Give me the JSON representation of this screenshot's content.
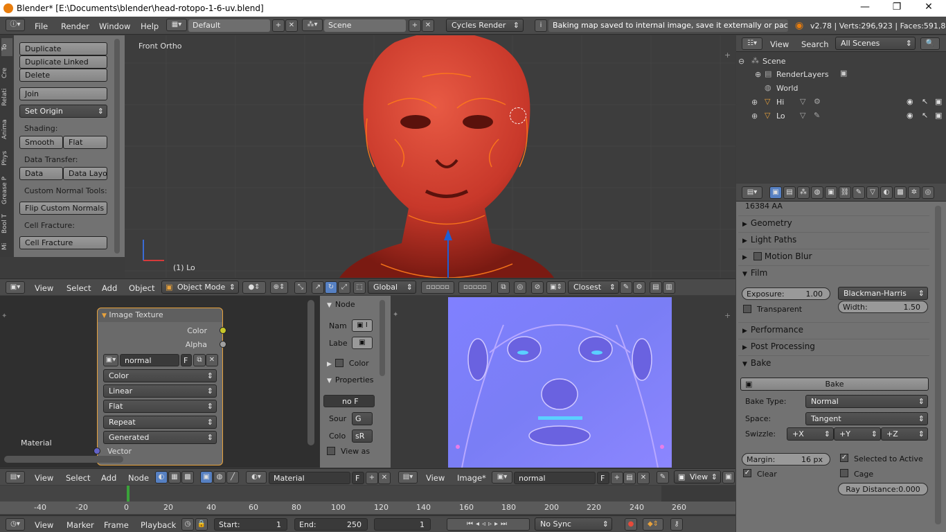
{
  "window": {
    "title": "Blender* [E:\\Documents\\blender\\head-rotopo-1-6-uv.blend]",
    "minimize": "—",
    "maximize": "❐",
    "close": "✕"
  },
  "topbar": {
    "menus": [
      "File",
      "Render",
      "Window",
      "Help"
    ],
    "screen_layout": "Default",
    "scene": "Scene",
    "render_engine": "Cycles Render",
    "status_message": "Baking map saved to internal image, save it externally or pack it",
    "stats": "v2.78 | Verts:296,923 | Faces:591,80"
  },
  "tool_shelf": {
    "tabs": [
      "To",
      "Cre",
      "Relati",
      "Anima",
      "Phys",
      "Grease P",
      "Bool T",
      "Mi"
    ],
    "buttons": {
      "duplicate": "Duplicate",
      "duplicate_linked": "Duplicate Linked",
      "delete": "Delete",
      "join": "Join",
      "set_origin": "Set Origin",
      "smooth": "Smooth",
      "flat": "Flat",
      "data": "Data",
      "data_layout": "Data Layo",
      "flip_normals": "Flip Custom Normals",
      "cell_fracture": "Cell Fracture"
    },
    "labels": {
      "shading": "Shading:",
      "data_transfer": "Data Transfer:",
      "custom_normal": "Custom Normal Tools:",
      "cell_fracture": "Cell Fracture:"
    }
  },
  "viewport": {
    "view_name": "Front Ortho",
    "object_label": "(1) Lo",
    "header": {
      "view": "View",
      "select": "Select",
      "add": "Add",
      "object": "Object",
      "mode": "Object Mode",
      "orientation": "Global",
      "snap": "Closest"
    }
  },
  "node_editor": {
    "node_title": "Image Texture",
    "outputs": [
      "Color",
      "Alpha"
    ],
    "image_name": "normal",
    "image_f": "F",
    "color_space": "Color",
    "interpolation": "Linear",
    "projection": "Flat",
    "extension": "Repeat",
    "source": "Generated",
    "input_vector": "Vector",
    "material_label": "Material",
    "side_panel": {
      "node_header": "Node",
      "name_label": "Nam",
      "label_label": "Labe",
      "color_header": "Color",
      "properties_header": "Properties",
      "image_short": "no",
      "image_f": "F",
      "source_label": "Sour",
      "source_value": "G",
      "color_label": "Colo",
      "color_value": "sR",
      "view_as": "View as"
    },
    "header": {
      "view": "View",
      "select": "Select",
      "add": "Add",
      "node": "Node",
      "material": "Material",
      "f": "F"
    }
  },
  "image_editor": {
    "header": {
      "view": "View",
      "image": "Image*",
      "image_name": "normal",
      "f": "F",
      "view_mode": "View"
    }
  },
  "timeline": {
    "ticks": [
      "-40",
      "-20",
      "0",
      "20",
      "40",
      "60",
      "80",
      "100",
      "120",
      "140",
      "160",
      "180",
      "200",
      "220",
      "240",
      "260"
    ],
    "header": {
      "view": "View",
      "marker": "Marker",
      "frame": "Frame",
      "playback": "Playback",
      "start_label": "Start:",
      "start_value": "1",
      "end_label": "End:",
      "end_value": "250",
      "current": "1",
      "sync": "No Sync"
    }
  },
  "outliner": {
    "view": "View",
    "search": "Search",
    "filter": "All Scenes",
    "items": {
      "scene": "Scene",
      "render_layers": "RenderLayers",
      "world": "World",
      "hi": "Hi",
      "lo": "Lo"
    }
  },
  "properties": {
    "aa_label": "16384 AA",
    "panels": {
      "geometry": "Geometry",
      "light_paths": "Light Paths",
      "motion_blur": "Motion Blur",
      "film": "Film",
      "performance": "Performance",
      "post_processing": "Post Processing",
      "bake": "Bake"
    },
    "film": {
      "exposure_label": "Exposure:",
      "exposure_value": "1.00",
      "filter": "Blackman-Harris",
      "transparent": "Transparent",
      "width_label": "Width:",
      "width_value": "1.50"
    },
    "bake": {
      "bake_button": "Bake",
      "bake_type_label": "Bake Type:",
      "bake_type": "Normal",
      "space_label": "Space:",
      "space": "Tangent",
      "swizzle_label": "Swizzle:",
      "swizzle": [
        "+X",
        "+Y",
        "+Z"
      ],
      "margin_label": "Margin:",
      "margin_value": "16 px",
      "selected_to_active": "Selected to Active",
      "clear": "Clear",
      "cage": "Cage",
      "ray_distance": "Ray Distance:0.000"
    }
  }
}
